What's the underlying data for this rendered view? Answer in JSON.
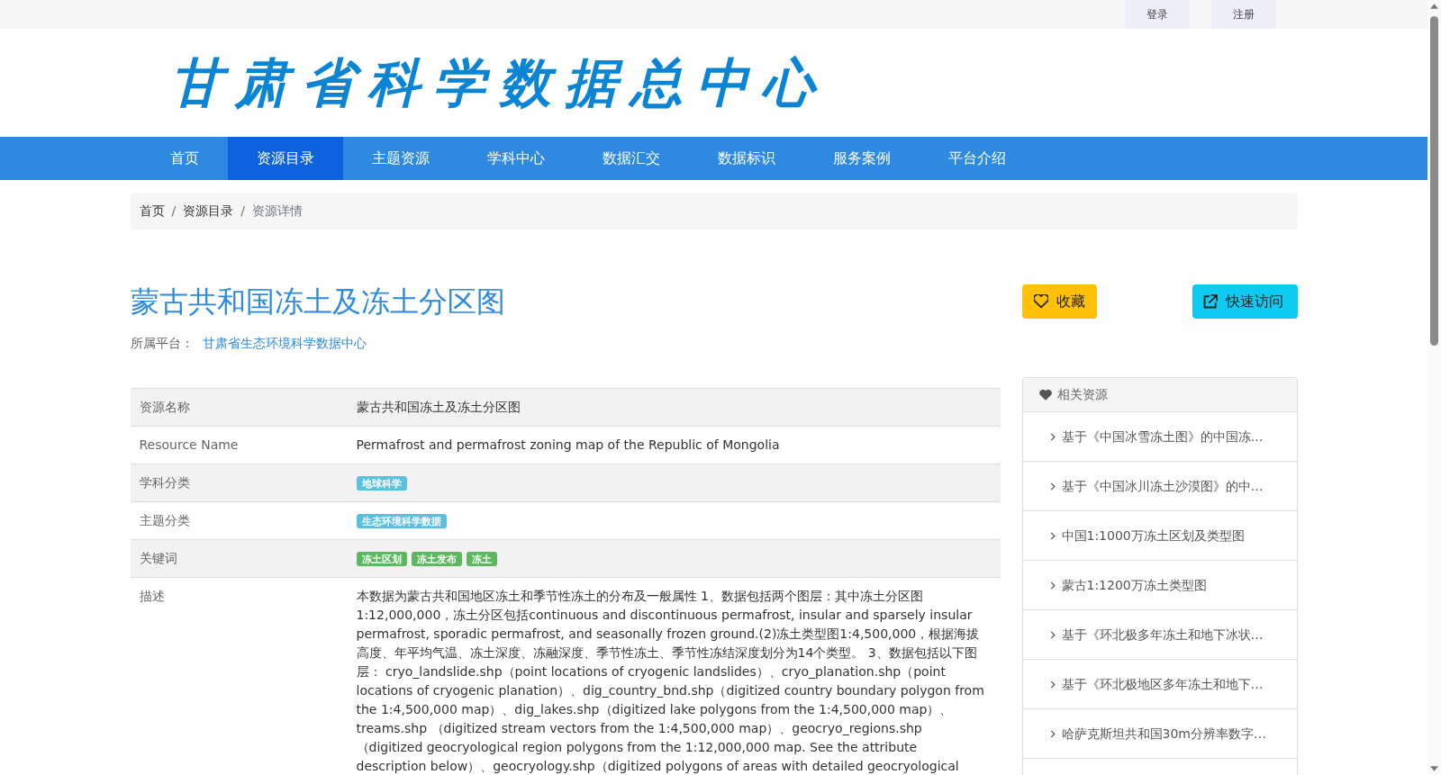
{
  "top_bar": {
    "buttons": [
      "登录",
      "注册"
    ]
  },
  "header": {
    "logo_text": "甘肃省科学数据总中心"
  },
  "nav": {
    "items": [
      {
        "label": "首页",
        "selected": false
      },
      {
        "label": "资源目录",
        "selected": true
      },
      {
        "label": "主题资源",
        "selected": false
      },
      {
        "label": "学科中心",
        "selected": false
      },
      {
        "label": "数据汇交",
        "selected": false
      },
      {
        "label": "数据标识",
        "selected": false
      },
      {
        "label": "服务案例",
        "selected": false
      },
      {
        "label": "平台介绍",
        "selected": false
      }
    ]
  },
  "breadcrumb": {
    "items": [
      {
        "label": "首页",
        "current": false
      },
      {
        "label": "资源目录",
        "current": false
      },
      {
        "label": "资源详情",
        "current": true
      }
    ],
    "separators": [
      "/",
      "/"
    ]
  },
  "resource": {
    "title": "蒙古共和国冻土及冻土分区图",
    "platform_label": "所属平台：",
    "platform_link": "甘肃省生态环境科学数据中心",
    "actions": [
      {
        "label": "收藏",
        "kind": "favorite"
      },
      {
        "label": "快速访问",
        "kind": "visit"
      }
    ]
  },
  "details": {
    "rows": [
      {
        "label": "资源名称",
        "kind": "text",
        "value": "蒙古共和国冻土及冻土分区图"
      },
      {
        "label": "Resource Name",
        "kind": "text",
        "value": "Permafrost and permafrost zoning map of the Republic of Mongolia"
      },
      {
        "label": "学科分类",
        "kind": "tags",
        "tags": [
          {
            "label": "地球科学",
            "color": "#5bc0de"
          }
        ]
      },
      {
        "label": "主题分类",
        "kind": "tags",
        "tags": [
          {
            "label": "生态环境科学数据",
            "color": "#5bc0de"
          }
        ]
      },
      {
        "label": "关键词",
        "kind": "tags",
        "tags": [
          {
            "label": "冻土区划",
            "color": "#5cb85c"
          },
          {
            "label": "冻土发布",
            "color": "#5cb85c"
          },
          {
            "label": "冻土",
            "color": "#5cb85c"
          }
        ]
      },
      {
        "label": "描述",
        "kind": "text",
        "value": "本数据为蒙古共和国地区冻土和季节性冻土的分布及一般属性 1、数据包括两个图层：其中冻土分区图1:12,000,000，冻土分区包括continuous and discontinuous permafrost, insular and sparsely insular permafrost, sporadic permafrost, and seasonally frozen ground.(2)冻土类型图1:4,500,000，根据海拔高度、年平均气温、冻土深度、冻融深度、季节性冻土、季节性冻结深度划分为14个类型。 3、数据包括以下图层： cryo_landslide.shp（point locations of cryogenic landslides）、cryo_planation.shp（point locations of cryogenic planation）、dig_country_bnd.shp（digitized country boundary polygon from the 1:4,500,000 map）、dig_lakes.shp（digitized lake polygons from the 1:4,500,000 map）、treams.shp （digitized stream vectors from the 1:4,500,000 map）、geocryo_regions.shp（digitized geocryological region polygons from the 1:12,000,000 map. See the attribute description below）、geocryology.shp（digitized polygons of areas with detailed geocryological"
      }
    ]
  },
  "related": {
    "title": "相关资源",
    "items": [
      "基于《中国冰雪冻土图》的中国冻…",
      "基于《中国冰川冻土沙漠图》的中…",
      "中国1:1000万冻土区划及类型图",
      "蒙古1:1200万冻土类型图",
      "基于《环北极多年冻土和地下冰状…",
      "基于《环北极地区多年冻土和地下…",
      "哈萨克斯坦共和国30m分辨率数字…"
    ]
  }
}
